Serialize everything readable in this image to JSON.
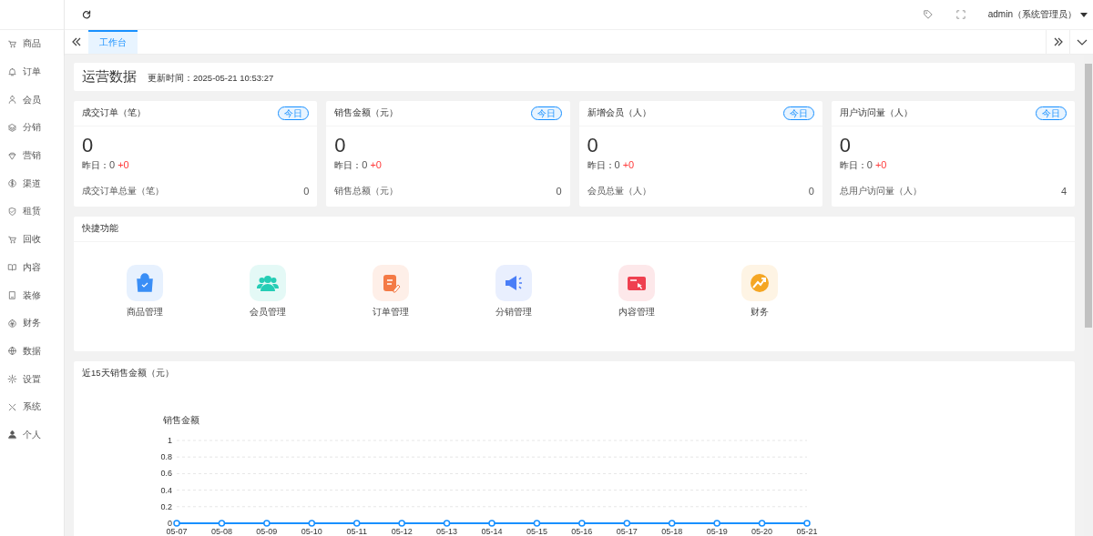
{
  "header": {
    "user": "admin（系统管理员）"
  },
  "sidebar": {
    "items": [
      {
        "label": "商品"
      },
      {
        "label": "订单"
      },
      {
        "label": "会员"
      },
      {
        "label": "分销"
      },
      {
        "label": "营销"
      },
      {
        "label": "渠道"
      },
      {
        "label": "租赁"
      },
      {
        "label": "回收"
      },
      {
        "label": "内容"
      },
      {
        "label": "装修"
      },
      {
        "label": "财务"
      },
      {
        "label": "数据"
      },
      {
        "label": "设置"
      },
      {
        "label": "系统"
      },
      {
        "label": "个人"
      }
    ]
  },
  "tabs": [
    {
      "label": "工作台",
      "selected": true
    }
  ],
  "overview": {
    "title": "运营数据",
    "updated": "更新时间：2025-05-21 10:53:27"
  },
  "stats": [
    {
      "title": "成交订单（笔）",
      "badge": "今日",
      "value": "0",
      "yesterday_label": "昨日：",
      "yesterday_value": "0",
      "change": "+0",
      "total_label": "成交订单总量（笔）",
      "total_value": "0"
    },
    {
      "title": "销售金额（元）",
      "badge": "今日",
      "value": "0",
      "yesterday_label": "昨日：",
      "yesterday_value": "0",
      "change": "+0",
      "total_label": "销售总额（元）",
      "total_value": "0"
    },
    {
      "title": "新增会员（人）",
      "badge": "今日",
      "value": "0",
      "yesterday_label": "昨日：",
      "yesterday_value": "0",
      "change": "+0",
      "total_label": "会员总量（人）",
      "total_value": "0"
    },
    {
      "title": "用户访问量（人）",
      "badge": "今日",
      "value": "0",
      "yesterday_label": "昨日：",
      "yesterday_value": "0",
      "change": "+0",
      "total_label": "总用户访问量（人）",
      "total_value": "4"
    }
  ],
  "quick": {
    "title": "快捷功能",
    "items": [
      {
        "label": "商品管理",
        "color": "#3a8ef6"
      },
      {
        "label": "会员管理",
        "color": "#25cdb5"
      },
      {
        "label": "订单管理",
        "color": "#f47a45"
      },
      {
        "label": "分销管理",
        "color": "#4a7ef7"
      },
      {
        "label": "内容管理",
        "color": "#ef4050"
      },
      {
        "label": "财务",
        "color": "#f5a623"
      }
    ]
  },
  "sales": {
    "title": "近15天销售金额（元）",
    "chart_data": {
      "type": "line",
      "ylabel": "销售金额",
      "categories": [
        "05-07",
        "05-08",
        "05-09",
        "05-10",
        "05-11",
        "05-12",
        "05-13",
        "05-14",
        "05-15",
        "05-16",
        "05-17",
        "05-18",
        "05-19",
        "05-20",
        "05-21"
      ],
      "series": [
        {
          "color": "#1890ff",
          "marker": true,
          "values": [
            0,
            0,
            0,
            0,
            0,
            0,
            0,
            0,
            0,
            0,
            0,
            0,
            0,
            0,
            0
          ]
        }
      ],
      "ylim": [
        0,
        1
      ],
      "yticks": [
        0,
        0.2,
        0.4,
        0.6,
        0.8,
        1
      ],
      "grid": true
    }
  }
}
